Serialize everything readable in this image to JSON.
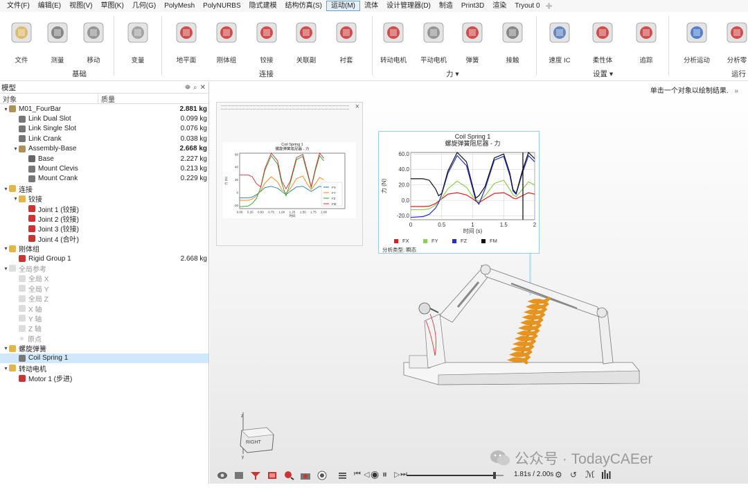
{
  "menu": [
    "文件(F)",
    "编辑(E)",
    "视图(V)",
    "草图(K)",
    "几何(G)",
    "PolyMesh",
    "PolyNURBS",
    "隐式建模",
    "结构仿真(S)",
    "运动(M)",
    "流体",
    "设计管理器(D)",
    "制造",
    "Print3D",
    "渲染",
    "Tryout 0"
  ],
  "menu_active": "运动(M)",
  "ribbon": {
    "buttons": [
      {
        "label": "文件",
        "icon": "files-icon"
      },
      {
        "label": "测量",
        "icon": "measure-icon"
      },
      {
        "label": "移动",
        "icon": "move-icon"
      },
      {
        "label": "变量",
        "icon": "variable-icon"
      },
      {
        "label": "地平面",
        "icon": "ground-icon"
      },
      {
        "label": "刚体组",
        "icon": "rigid-group-icon"
      },
      {
        "label": "铰接",
        "icon": "joint-icon"
      },
      {
        "label": "关联副",
        "icon": "coupler-icon"
      },
      {
        "label": "衬套",
        "icon": "bushing-icon"
      },
      {
        "label": "转动电机",
        "icon": "rotary-motor-icon"
      },
      {
        "label": "平动电机",
        "icon": "translational-motor-icon"
      },
      {
        "label": "弹簧",
        "icon": "spring-icon"
      },
      {
        "label": "接触",
        "icon": "contact-icon"
      },
      {
        "label": "速度 IC",
        "icon": "velocity-ic-icon"
      },
      {
        "label": "柔性体",
        "icon": "flexible-body-icon"
      },
      {
        "label": "追踪",
        "icon": "trace-icon"
      },
      {
        "label": "分析运动",
        "icon": "run-analysis-icon"
      },
      {
        "label": "分析零",
        "icon": "analyze-part-icon"
      }
    ],
    "groups": [
      {
        "label": "基础"
      },
      {
        "label": "连接"
      },
      {
        "label": "力 ▾"
      },
      {
        "label": "设置 ▾"
      },
      {
        "label": "运行"
      }
    ]
  },
  "browser": {
    "title": "模型",
    "col_object": "对象",
    "col_mass": "质量",
    "rows": [
      {
        "label": "M01_FourBar",
        "mass": "2.881 kg",
        "level": 0,
        "arrow": "▾",
        "bold": true,
        "icon": "assembly-icon",
        "grey": false,
        "sel": false
      },
      {
        "label": "Link Dual Slot",
        "mass": "0.099 kg",
        "level": 1,
        "arrow": "",
        "bold": false,
        "icon": "part-icon",
        "grey": false,
        "sel": false
      },
      {
        "label": "Link Single Slot",
        "mass": "0.076 kg",
        "level": 1,
        "arrow": "",
        "bold": false,
        "icon": "part-icon",
        "grey": false,
        "sel": false
      },
      {
        "label": "Link Crank",
        "mass": "0.038 kg",
        "level": 1,
        "arrow": "",
        "bold": false,
        "icon": "part-icon",
        "grey": false,
        "sel": false
      },
      {
        "label": "Assembly-Base",
        "mass": "2.668 kg",
        "level": 1,
        "arrow": "▾",
        "bold": true,
        "icon": "assembly-icon",
        "grey": false,
        "sel": false
      },
      {
        "label": "Base",
        "mass": "2.227 kg",
        "level": 2,
        "arrow": "",
        "bold": false,
        "icon": "ground-part-icon",
        "grey": false,
        "sel": false
      },
      {
        "label": "Mount Clevis",
        "mass": "0.213 kg",
        "level": 2,
        "arrow": "",
        "bold": false,
        "icon": "part-icon",
        "grey": false,
        "sel": false
      },
      {
        "label": "Mount Crank",
        "mass": "0.229 kg",
        "level": 2,
        "arrow": "",
        "bold": false,
        "icon": "part-icon",
        "grey": false,
        "sel": false
      },
      {
        "label": "连接",
        "mass": "",
        "level": 0,
        "arrow": "▾",
        "bold": false,
        "icon": "folder-icon",
        "grey": false,
        "sel": false
      },
      {
        "label": "铰接",
        "mass": "",
        "level": 1,
        "arrow": "▾",
        "bold": false,
        "icon": "folder-icon",
        "grey": false,
        "sel": false
      },
      {
        "label": "Joint 1 (铰接)",
        "mass": "",
        "level": 2,
        "arrow": "",
        "bold": false,
        "icon": "joint-icon",
        "grey": false,
        "sel": false
      },
      {
        "label": "Joint 2 (铰接)",
        "mass": "",
        "level": 2,
        "arrow": "",
        "bold": false,
        "icon": "joint-icon",
        "grey": false,
        "sel": false
      },
      {
        "label": "Joint 3 (铰接)",
        "mass": "",
        "level": 2,
        "arrow": "",
        "bold": false,
        "icon": "joint-icon",
        "grey": false,
        "sel": false
      },
      {
        "label": "Joint 4 (合叶)",
        "mass": "",
        "level": 2,
        "arrow": "",
        "bold": false,
        "icon": "joint-icon",
        "grey": false,
        "sel": false
      },
      {
        "label": "刚体组",
        "mass": "",
        "level": 0,
        "arrow": "▾",
        "bold": false,
        "icon": "folder-icon",
        "grey": false,
        "sel": false
      },
      {
        "label": "Rigid Group 1",
        "mass": "2.668 kg",
        "level": 1,
        "arrow": "",
        "bold": false,
        "icon": "rigid-group-icon",
        "grey": false,
        "sel": false
      },
      {
        "label": "全局参考",
        "mass": "",
        "level": 0,
        "arrow": "▾",
        "bold": false,
        "icon": "folder-icon",
        "grey": true,
        "sel": false
      },
      {
        "label": "全局 X",
        "mass": "",
        "level": 1,
        "arrow": "",
        "bold": false,
        "icon": "plane-icon",
        "grey": true,
        "sel": false
      },
      {
        "label": "全局 Y",
        "mass": "",
        "level": 1,
        "arrow": "",
        "bold": false,
        "icon": "plane-icon",
        "grey": true,
        "sel": false
      },
      {
        "label": "全局 Z",
        "mass": "",
        "level": 1,
        "arrow": "",
        "bold": false,
        "icon": "plane-icon",
        "grey": true,
        "sel": false
      },
      {
        "label": "X 轴",
        "mass": "",
        "level": 1,
        "arrow": "",
        "bold": false,
        "icon": "axis-icon",
        "grey": true,
        "sel": false
      },
      {
        "label": "Y 轴",
        "mass": "",
        "level": 1,
        "arrow": "",
        "bold": false,
        "icon": "axis-icon",
        "grey": true,
        "sel": false
      },
      {
        "label": "Z 轴",
        "mass": "",
        "level": 1,
        "arrow": "",
        "bold": false,
        "icon": "axis-icon",
        "grey": true,
        "sel": false
      },
      {
        "label": "原点",
        "mass": "",
        "level": 1,
        "arrow": "",
        "bold": false,
        "icon": "origin-icon",
        "grey": true,
        "sel": false
      },
      {
        "label": "螺旋弹簧",
        "mass": "",
        "level": 0,
        "arrow": "▾",
        "bold": false,
        "icon": "folder-icon",
        "grey": false,
        "sel": false
      },
      {
        "label": "Coil Spring 1",
        "mass": "",
        "level": 1,
        "arrow": "",
        "bold": false,
        "icon": "spring-icon",
        "grey": false,
        "sel": true
      },
      {
        "label": "转动电机",
        "mass": "",
        "level": 0,
        "arrow": "▾",
        "bold": false,
        "icon": "folder-icon",
        "grey": false,
        "sel": false
      },
      {
        "label": "Motor 1  (步进)",
        "mass": "",
        "level": 1,
        "arrow": "",
        "bold": false,
        "icon": "motor-icon",
        "grey": false,
        "sel": false
      }
    ]
  },
  "viewport": {
    "hint": "单击一个对象以绘制结果.",
    "hint_chevron": "»",
    "cube_label": "RIGHT",
    "watermark": "公众号 · TodayCAEer"
  },
  "playback": {
    "time": "1.81s / 2.00s",
    "progress": 0.905
  },
  "colors": {
    "FX": "#e41a1c",
    "FY": "#8dcf56",
    "FZ": "#1f2fd6",
    "FM": "#111111",
    "small_FX": "#1f77b4",
    "small_FY": "#ff7f0e",
    "small_FZ": "#2ca02c",
    "small_FM": "#d62728",
    "accent": "#6aa0d8",
    "selection": "#cfe8fb"
  },
  "chart_data": [
    {
      "type": "line",
      "title": "Coil Spring 1",
      "subtitle": "螺旋弹簧阻尼器 - 力",
      "xlabel": "时间 (s)",
      "ylabel": "力 (N)",
      "xlim": [
        0,
        2
      ],
      "ylim": [
        -25,
        62
      ],
      "xticks": [
        "0",
        "0.5",
        "1",
        "1.5",
        "2"
      ],
      "yticks": [
        "-20.0",
        "0.0",
        "20.0",
        "40.0",
        "60.0"
      ],
      "ytick_values": [
        -20,
        0,
        20,
        40,
        60
      ],
      "xtick_values": [
        0,
        0.5,
        1,
        1.5,
        2
      ],
      "cursor_x": 1.81,
      "analysis_type": "分析类型:  瞬态",
      "legend_pos": "bottom",
      "grid": true,
      "series": [
        {
          "name": "FX",
          "color": "#e41a1c",
          "x": [
            0,
            0.2,
            0.3,
            0.4,
            0.45,
            0.5,
            0.6,
            0.75,
            0.9,
            1.0,
            1.05,
            1.1,
            1.2,
            1.35,
            1.5,
            1.6,
            1.65,
            1.7,
            1.8,
            1.9,
            2.0
          ],
          "y": [
            -8,
            -8,
            -7.5,
            -4,
            -1,
            2,
            8,
            10,
            7,
            2,
            -1,
            -3,
            2,
            9,
            10,
            6,
            3,
            2,
            6,
            10,
            8
          ]
        },
        {
          "name": "FY",
          "color": "#8dcf56",
          "x": [
            0,
            0.2,
            0.3,
            0.4,
            0.45,
            0.5,
            0.6,
            0.75,
            0.9,
            1.0,
            1.05,
            1.1,
            1.2,
            1.35,
            1.5,
            1.6,
            1.65,
            1.7,
            1.8,
            1.9,
            2.0
          ],
          "y": [
            -12,
            -12,
            -11,
            -6,
            -2,
            3,
            15,
            25,
            17,
            5,
            1,
            -1,
            6,
            22,
            26,
            14,
            7,
            5,
            14,
            24,
            20
          ]
        },
        {
          "name": "FZ",
          "color": "#1f2fd6",
          "x": [
            0,
            0.2,
            0.3,
            0.4,
            0.45,
            0.5,
            0.6,
            0.75,
            0.9,
            1.0,
            1.05,
            1.1,
            1.2,
            1.35,
            1.5,
            1.6,
            1.65,
            1.7,
            1.8,
            1.9,
            2.0
          ],
          "y": [
            -22,
            -21,
            -18,
            -10,
            -3,
            8,
            35,
            58,
            45,
            15,
            0,
            -5,
            15,
            52,
            57,
            32,
            12,
            8,
            35,
            58,
            50
          ]
        },
        {
          "name": "FM",
          "color": "#111111",
          "x": [
            0,
            0.2,
            0.3,
            0.4,
            0.45,
            0.5,
            0.6,
            0.75,
            0.9,
            1.0,
            1.05,
            1.1,
            1.2,
            1.35,
            1.5,
            1.6,
            1.65,
            1.7,
            1.8,
            1.9,
            2.0
          ],
          "y": [
            28,
            28,
            26,
            15,
            6,
            9,
            38,
            62,
            50,
            18,
            3,
            6,
            18,
            55,
            60,
            35,
            14,
            9,
            38,
            62,
            54
          ]
        }
      ]
    },
    {
      "type": "line",
      "title": "Coil Spring 1",
      "subtitle": "螺旋弹簧阻尼器 - 力",
      "xlabel": "时间",
      "ylabel": "力 (N)",
      "xlim": [
        0,
        2.5
      ],
      "ylim": [
        -25,
        62
      ],
      "xticks": [
        "0.00",
        "0.25",
        "0.50",
        "0.75",
        "1.00",
        "1.25",
        "1.50",
        "1.75",
        "2.00"
      ],
      "yticks": [
        "-20",
        "0",
        "20",
        "40",
        "60"
      ],
      "ytick_values": [
        -20,
        0,
        20,
        40,
        60
      ],
      "xtick_values": [
        0,
        0.25,
        0.5,
        0.75,
        1,
        1.25,
        1.5,
        1.75,
        2
      ],
      "legend_pos": "lower right",
      "grid": false,
      "series": [
        {
          "name": "FX",
          "color": "#1f77b4",
          "x": [
            0,
            0.2,
            0.3,
            0.4,
            0.5,
            0.6,
            0.75,
            0.9,
            1.0,
            1.1,
            1.2,
            1.35,
            1.5,
            1.6,
            1.7,
            1.8,
            1.9,
            2.0
          ],
          "y": [
            -8,
            -8,
            -7,
            -3,
            2,
            8,
            10,
            7,
            2,
            -3,
            2,
            9,
            10,
            6,
            2,
            6,
            10,
            8
          ]
        },
        {
          "name": "FY",
          "color": "#ff7f0e",
          "x": [
            0,
            0.2,
            0.3,
            0.4,
            0.5,
            0.6,
            0.75,
            0.9,
            1.0,
            1.1,
            1.2,
            1.35,
            1.5,
            1.6,
            1.7,
            1.8,
            1.9,
            2.0
          ],
          "y": [
            -12,
            -12,
            -10,
            -5,
            3,
            15,
            25,
            17,
            5,
            -1,
            6,
            22,
            26,
            14,
            5,
            14,
            24,
            20
          ]
        },
        {
          "name": "FZ",
          "color": "#2ca02c",
          "x": [
            0,
            0.2,
            0.3,
            0.4,
            0.5,
            0.6,
            0.75,
            0.9,
            1.0,
            1.1,
            1.2,
            1.35,
            1.5,
            1.6,
            1.7,
            1.8,
            1.9,
            2.0
          ],
          "y": [
            -22,
            -21,
            -17,
            -9,
            8,
            35,
            58,
            45,
            15,
            -5,
            15,
            52,
            57,
            32,
            8,
            35,
            58,
            50
          ]
        },
        {
          "name": "FM",
          "color": "#d62728",
          "x": [
            0,
            0.2,
            0.3,
            0.4,
            0.5,
            0.6,
            0.75,
            0.9,
            1.0,
            1.1,
            1.2,
            1.35,
            1.5,
            1.6,
            1.7,
            1.8,
            1.9,
            2.0
          ],
          "y": [
            28,
            28,
            25,
            14,
            9,
            38,
            62,
            50,
            18,
            6,
            18,
            55,
            60,
            35,
            9,
            38,
            62,
            54
          ]
        }
      ]
    }
  ]
}
